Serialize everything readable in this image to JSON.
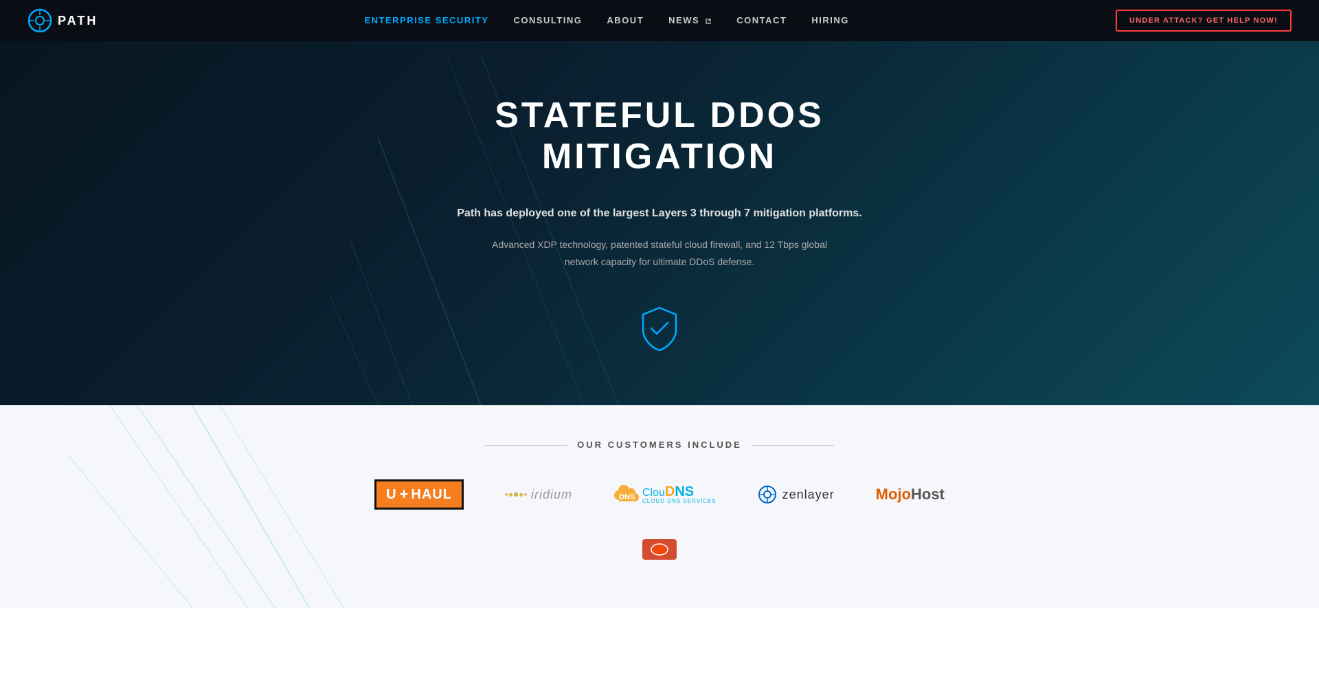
{
  "navbar": {
    "logo_text": "PATH",
    "nav_items": [
      {
        "label": "ENTERPRISE SECURITY",
        "href": "#",
        "active": true,
        "external": false
      },
      {
        "label": "CONSULTING",
        "href": "#",
        "active": false,
        "external": false
      },
      {
        "label": "ABOUT",
        "href": "#",
        "active": false,
        "external": false
      },
      {
        "label": "NEWS",
        "href": "#",
        "active": false,
        "external": true
      },
      {
        "label": "CONTACT",
        "href": "#",
        "active": false,
        "external": false
      },
      {
        "label": "HIRING",
        "href": "#",
        "active": false,
        "external": false
      }
    ],
    "cta_label": "UNDER ATTACK? GET HELP NOW!"
  },
  "hero": {
    "title": "STATEFUL DDOS MITIGATION",
    "subtitle": "Path has deployed one of the largest Layers 3 through 7 mitigation platforms.",
    "description": "Advanced XDP technology, patented stateful cloud firewall, and 12 Tbps global\nnetwork capacity for ultimate DDoS defense."
  },
  "customers": {
    "section_title": "OUR CUSTOMERS INCLUDE",
    "logos": [
      {
        "name": "U-HAUL",
        "type": "uhaul"
      },
      {
        "name": "iridium",
        "type": "iridium"
      },
      {
        "name": "ClouDNS",
        "type": "cloudns"
      },
      {
        "name": "zenlayer",
        "type": "zenlayer"
      },
      {
        "name": "MojoHost",
        "type": "mojohost"
      }
    ]
  }
}
